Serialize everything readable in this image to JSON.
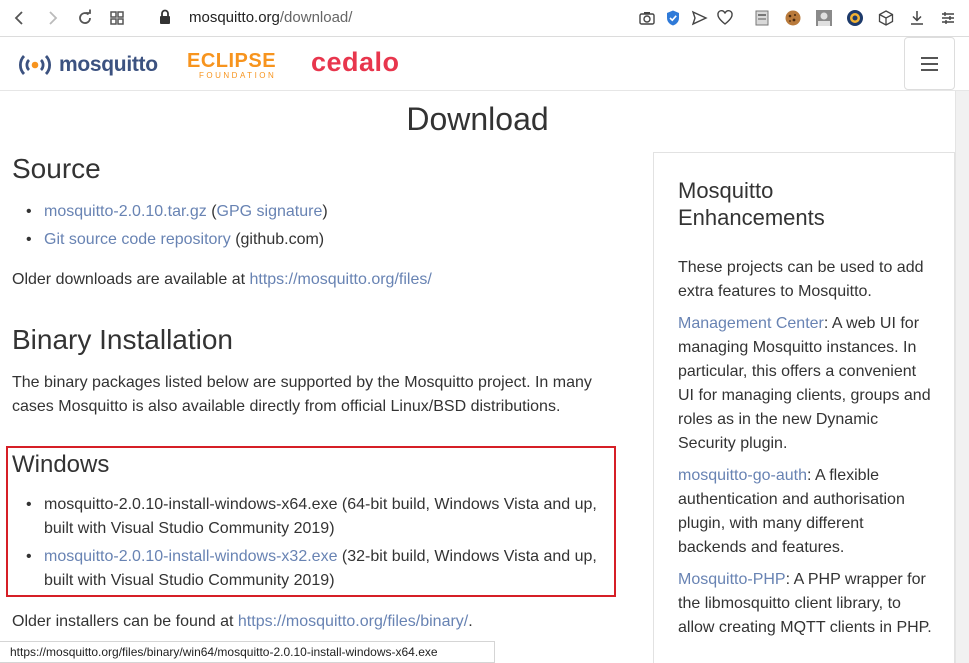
{
  "browser": {
    "url_host": "mosquitto.org",
    "url_path": "/download/",
    "status_url": "https://mosquitto.org/files/binary/win64/mosquitto-2.0.10-install-windows-x64.exe"
  },
  "header": {
    "logo_mosquitto": "mosquitto",
    "logo_eclipse": "ECLIPSE",
    "logo_eclipse_sub": "FOUNDATION",
    "logo_cedalo": "cedalo"
  },
  "page": {
    "title": "Download",
    "source": {
      "heading": "Source",
      "items": [
        {
          "link": "mosquitto-2.0.10.tar.gz",
          "paren_open": " (",
          "link2": "GPG signature",
          "paren_close": ")"
        },
        {
          "link": "Git source code repository",
          "rest": " (github.com)"
        }
      ],
      "older_text": "Older downloads are available at ",
      "older_link": "https://mosquitto.org/files/"
    },
    "binary": {
      "heading": "Binary Installation",
      "text_line1": "The binary packages listed below are supported by the Mosquitto project. In many",
      "text_line2": "cases Mosquitto is also available directly from official Linux/BSD distributions."
    },
    "windows": {
      "heading": "Windows",
      "items": [
        {
          "file": "mosquitto-2.0.10-install-windows-x64.exe",
          "desc_line1": " (64-bit build, Windows Vista and up,",
          "desc_line2": "built with Visual Studio Community 2019)"
        },
        {
          "file": "mosquitto-2.0.10-install-windows-x32.exe",
          "desc_line1": " (32-bit build, Windows Vista and up,",
          "desc_line2": "built with Visual Studio Community 2019)"
        }
      ],
      "older_text": "Older installers can be found at ",
      "older_link": "https://mosquitto.org/files/binary/",
      "older_end": "."
    }
  },
  "sidebar": {
    "title_line1": "Mosquitto",
    "title_line2": "Enhancements",
    "intro_line1": "These projects can be used to add",
    "intro_line2": "extra features to Mosquitto.",
    "mc_link": "Management Center",
    "mc_l1": ": A web UI for",
    "mc_l2": "managing Mosquitto instances. In",
    "mc_l3": "particular, this offers a convenient",
    "mc_l4": "UI for managing clients, groups and",
    "mc_l5": "roles as in the new Dynamic",
    "mc_l6": "Security plugin.",
    "goauth_link": "mosquitto-go-auth",
    "goauth_l1": ": A flexible",
    "goauth_l2": "authentication and authorisation",
    "goauth_l3": "plugin, with many different",
    "goauth_l4": "backends and features.",
    "php_link": "Mosquitto-PHP",
    "php_l1": ": A PHP wrapper for",
    "php_l2": "the libmosquitto client library, to",
    "php_l3": "allow creating MQTT clients in PHP."
  },
  "colors": {
    "link": "#6883b3",
    "highlight_box": "#d61f26",
    "cedalo": "#e8364d",
    "eclipse": "#f7941e",
    "mosquitto_logo": "#3c5280"
  },
  "icons": [
    "back-icon",
    "forward-icon",
    "reload-icon",
    "apps-icon",
    "lock-icon",
    "camera-icon",
    "shield-icon",
    "send-icon",
    "heart-icon",
    "extension-icon",
    "cookie-icon",
    "avatar-icon",
    "extension-icon",
    "cube-icon",
    "download-icon",
    "menu-icon"
  ]
}
